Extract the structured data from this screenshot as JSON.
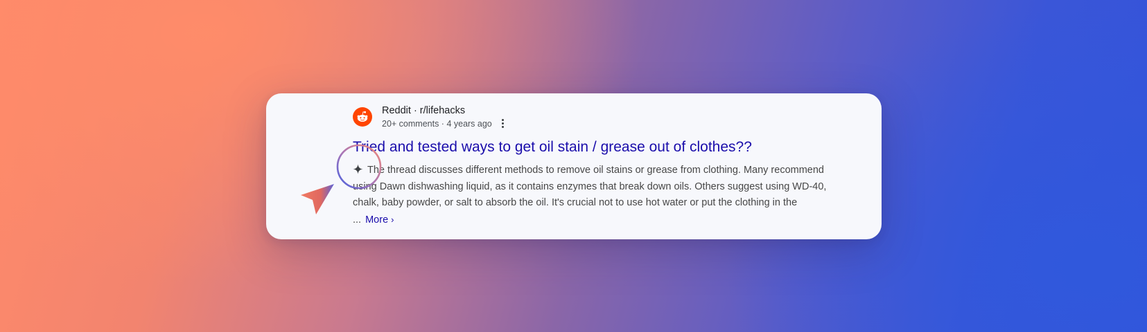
{
  "result": {
    "site": "Reddit · r/lifehacks",
    "meta": "20+ comments · 4 years ago",
    "title": "Tried and tested ways to get oil stain / grease out of clothes??",
    "snippet": "The thread discusses different methods to remove oil stains or grease from clothing. Many recommend using Dawn dishwashing liquid, as it contains enzymes that break down oils. Others suggest using WD-40, chalk, baby powder, or salt to absorb the oil. It's crucial not to use hot water or put the clothing in the ...",
    "more_label": "More",
    "favicon_icon": "reddit-icon",
    "options_icon": "more-vert-icon",
    "ai_icon": "sparkle-icon"
  },
  "colors": {
    "title_link": "#1a0dab",
    "reddit_brand": "#ff4500",
    "card_bg": "#f7f8fc"
  }
}
